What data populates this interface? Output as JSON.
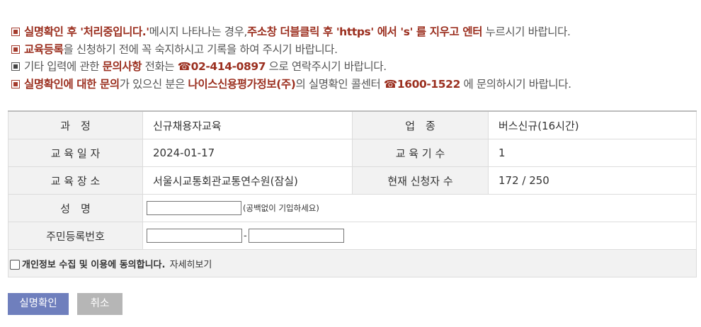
{
  "notices": [
    {
      "parts_a": "실명확인 후 '처리중입니다.'",
      "parts_b": "메시지 나타나는 경우,",
      "parts_c": "주소창 더블클릭 후 'https' 에서 's' 를 지우고 엔터",
      "parts_d": " 누르시기 바랍니다."
    },
    {
      "parts_a": "교육등록",
      "parts_b": "을 신청하기 전에 꼭 숙지하시고 기록을 하여 주시기 바랍니다."
    },
    {
      "parts_a": "기타 입력에 관한 ",
      "parts_b": "문의사항",
      "parts_c": " 전화는 ",
      "phone_icon": "☎",
      "phone": "02-414-0897",
      "parts_d": " 으로 연락주시기 바랍니다."
    },
    {
      "parts_a": "실명확인에 대한 문의",
      "parts_b": "가 있으신 분은 ",
      "parts_c": "나이스신용평가정보(주)",
      "parts_d": "의 실명확인 콜센터 ",
      "phone_icon": "☎",
      "phone": "1600-1522",
      "parts_e": " 에 문의하시기 바랍니다."
    }
  ],
  "info": {
    "course_label": "과　정",
    "course_value": "신규채용자교육",
    "industry_label": "업　종",
    "industry_value": "버스신규(16시간)",
    "date_label": "교 육 일 자",
    "date_value": "2024-01-17",
    "session_label": "교 육 기 수",
    "session_value": "1",
    "place_label": "교 육 장 소",
    "place_value": "서울시교통회관교통연수원(잠실)",
    "applicants_label": "현재 신청자 수",
    "applicants_value": "172 / 250"
  },
  "form": {
    "name_label": "성　명",
    "name_value": "",
    "name_hint": "(공백없이 기입하세요)",
    "rrn_label": "주민등록번호",
    "rrn_front_value": "",
    "rrn_dash": "-",
    "rrn_back_value": ""
  },
  "agree": {
    "text": "개인정보 수집 및 이용에 동의합니다.",
    "more": "자세히보기"
  },
  "buttons": {
    "confirm": "실명확인",
    "cancel": "취소"
  }
}
